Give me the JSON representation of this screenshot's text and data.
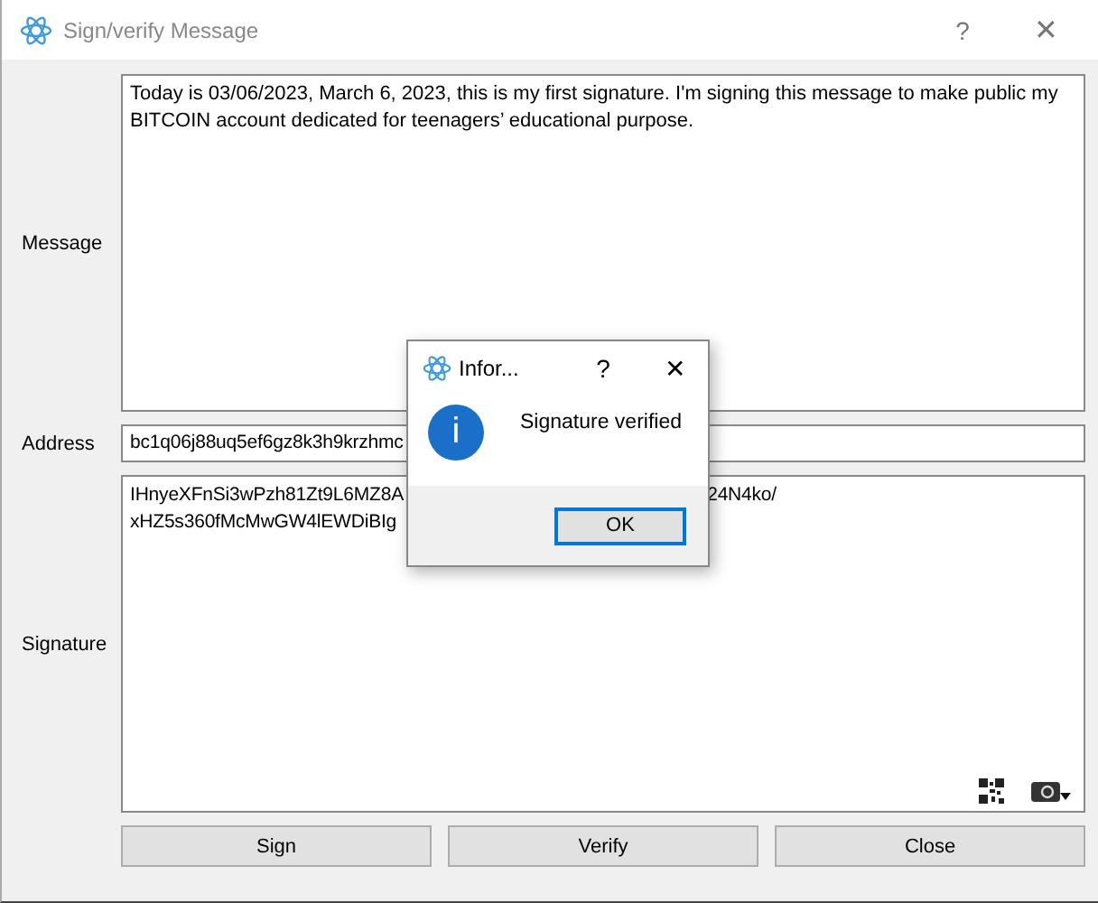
{
  "window": {
    "title": "Sign/verify Message",
    "help": "?",
    "close": "✕"
  },
  "message": {
    "label": "Message",
    "text": "Today is 03/06/2023, March 6, 2023, this is my first signature. I'm signing this message to make public my BITCOIN account dedicated for teenagers’ educational purpose."
  },
  "address": {
    "label": "Address",
    "value": "bc1q06j88uq5ef6gz8k3h9krzhmc"
  },
  "signature": {
    "label": "Signature",
    "lines": [
      {
        "start": "IHnyeXFnSi3wPzh81Zt9L6MZ8A",
        "end": "24N4ko/"
      },
      {
        "start": "xHZ5s360fMcMwGW4lEWDiBIg"
      }
    ]
  },
  "buttons": [
    "Sign",
    "Verify",
    "Close"
  ],
  "dialog": {
    "title": "Infor...",
    "help": "?",
    "close": "✕",
    "icon": "i",
    "text": "Signature verified",
    "button": "OK"
  }
}
